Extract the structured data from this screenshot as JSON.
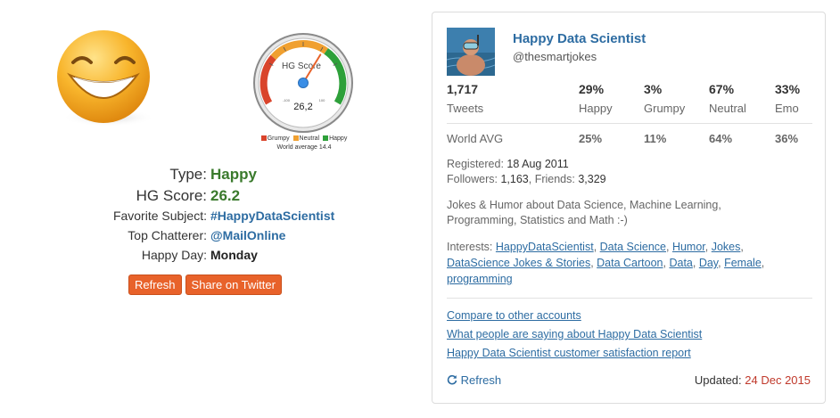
{
  "left": {
    "gauge": {
      "title": "HG Score",
      "value": "26.2",
      "value_display": "26,2",
      "min_label": "-100",
      "max_label": "100",
      "needle_value": 26.2,
      "legend": [
        {
          "label": "Grumpy",
          "color": "#d9442b"
        },
        {
          "label": "Neutral",
          "color": "#f0a030"
        },
        {
          "label": "Happy",
          "color": "#2ea03a"
        }
      ],
      "world_average": "World average 14.4"
    },
    "stats": {
      "type_label": "Type:",
      "type_value": "Happy",
      "score_label": "HG Score:",
      "score_value": "26.2",
      "subject_label": "Favorite Subject:",
      "subject_value": "#HappyDataScientist",
      "chatterer_label": "Top Chatterer:",
      "chatterer_value": "@MailOnline",
      "day_label": "Happy Day:",
      "day_value": "Monday"
    },
    "buttons": {
      "refresh": "Refresh",
      "share": "Share on Twitter"
    }
  },
  "card": {
    "name": "Happy Data Scientist",
    "handle": "@thesmartjokes",
    "metrics": [
      {
        "value": "1,717",
        "label": "Tweets"
      },
      {
        "value": "29%",
        "label": "Happy"
      },
      {
        "value": "3%",
        "label": "Grumpy"
      },
      {
        "value": "67%",
        "label": "Neutral"
      },
      {
        "value": "33%",
        "label": "Emo"
      }
    ],
    "world_avg": {
      "label": "World AVG",
      "values": [
        "25%",
        "11%",
        "64%",
        "36%"
      ]
    },
    "registered_label": "Registered:",
    "registered_value": "18 Aug 2011",
    "followers_label": "Followers:",
    "followers_value": "1,163",
    "friends_label": "Friends:",
    "friends_value": "3,329",
    "bio": "Jokes & Humor about Data Science, Machine Learning, Programming, Statistics and Math :-)",
    "interests_label": "Interests:",
    "interests": [
      "HappyDataScientist",
      "Data Science",
      "Humor",
      "Jokes",
      "DataScience Jokes & Stories",
      "Data Cartoon",
      "Data",
      "Day",
      "Female",
      "programming"
    ],
    "links": [
      "Compare to other accounts",
      "What people are saying about Happy Data Scientist",
      "Happy Data Scientist customer satisfaction report"
    ],
    "refresh": "Refresh",
    "updated_label": "Updated:",
    "updated_date": "24 Dec 2015"
  }
}
